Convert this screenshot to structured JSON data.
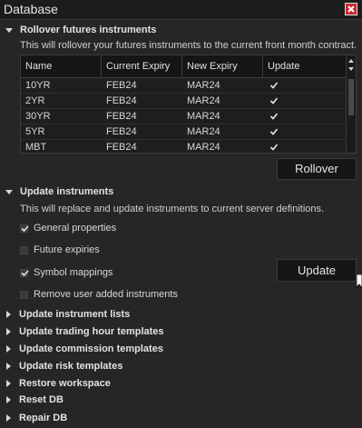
{
  "window": {
    "title": "Database"
  },
  "rollover": {
    "header": "Rollover futures instruments",
    "description": "This will rollover your futures instruments to the current front month contract.",
    "columns": [
      "Name",
      "Current Expiry",
      "New Expiry",
      "Update"
    ],
    "rows": [
      {
        "name": "10YR",
        "current": "FEB24",
        "new": "MAR24",
        "update": true
      },
      {
        "name": "2YR",
        "current": "FEB24",
        "new": "MAR24",
        "update": true
      },
      {
        "name": "30YR",
        "current": "FEB24",
        "new": "MAR24",
        "update": true
      },
      {
        "name": "5YR",
        "current": "FEB24",
        "new": "MAR24",
        "update": true
      },
      {
        "name": "MBT",
        "current": "FEB24",
        "new": "MAR24",
        "update": true
      }
    ],
    "button": "Rollover"
  },
  "update_instruments": {
    "header": "Update instruments",
    "description": "This will replace and update instruments to current server definitions.",
    "options": [
      {
        "label": "General properties",
        "checked": true
      },
      {
        "label": "Future expiries",
        "checked": false
      },
      {
        "label": "Symbol mappings",
        "checked": true
      },
      {
        "label": "Remove user added instruments",
        "checked": false
      }
    ],
    "button": "Update"
  },
  "collapsed_sections": [
    "Update instrument lists",
    "Update trading hour templates",
    "Update commission templates",
    "Update risk templates",
    "Restore workspace",
    "Reset DB",
    "Repair DB"
  ],
  "colors": {
    "background": "#262626",
    "close": "#c8282c",
    "text": "#d8d8d8"
  }
}
